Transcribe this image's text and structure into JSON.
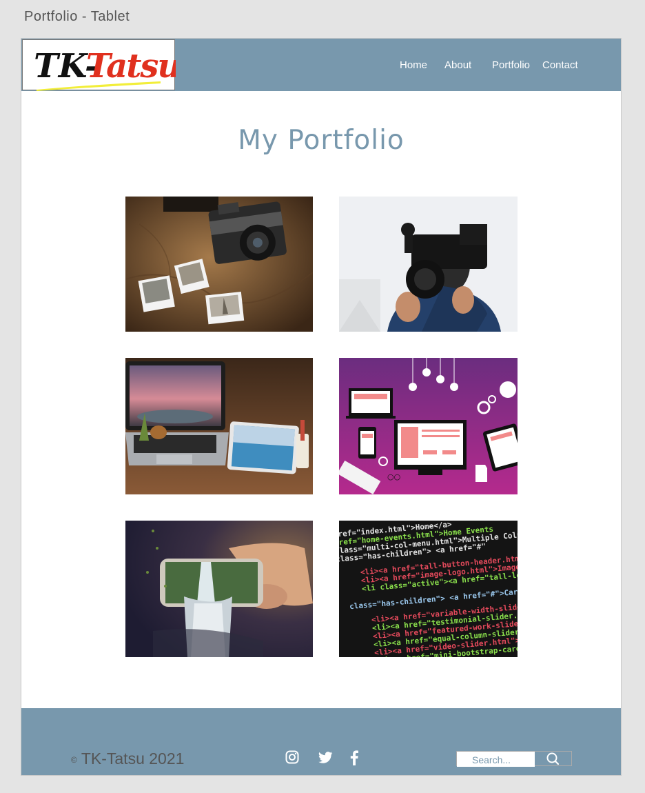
{
  "frame_title": "Portfolio - Tablet",
  "logo": {
    "text_part1": "TK-",
    "text_part2": "Tatsu"
  },
  "nav": [
    {
      "label": "Home"
    },
    {
      "label": "About"
    },
    {
      "label": "Portfolio"
    },
    {
      "label": "Contact"
    }
  ],
  "main": {
    "title": "My Portfolio",
    "gallery": [
      {
        "subject": "vintage camera with polaroid photos on map"
      },
      {
        "subject": "person holding video camera"
      },
      {
        "subject": "laptop and tablet with landscape scenes"
      },
      {
        "subject": "responsive web design devices illustration"
      },
      {
        "subject": "smartphone with waterfall emerging"
      },
      {
        "subject": "HTML source code on dark screen"
      }
    ]
  },
  "footer": {
    "copyright_symbol": "©",
    "copyright_text": "TK-Tatsu 2021",
    "social_icons": [
      "instagram-icon",
      "twitter-icon",
      "facebook-icon"
    ],
    "search_placeholder": "Search..."
  },
  "colors": {
    "nav_bg": "#7898ad",
    "footer_bg": "#7898ad",
    "title": "#7898ad",
    "page_bg": "#e4e4e4",
    "logo_red": "#e0301e"
  }
}
